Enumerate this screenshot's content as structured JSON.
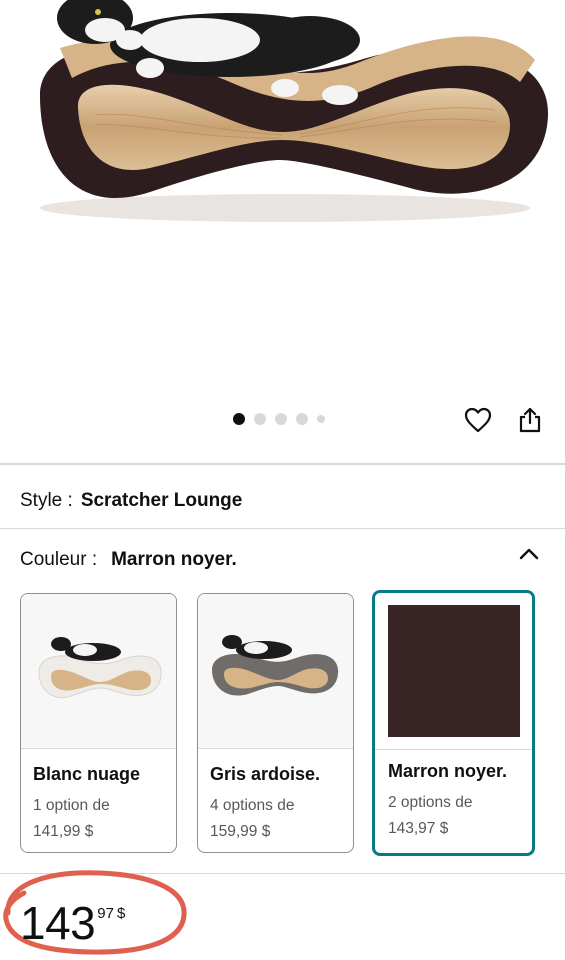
{
  "product": {
    "style_label": "Style :",
    "style_value": "Scratcher Lounge",
    "color_label": "Couleur :",
    "color_value": "Marron noyer."
  },
  "gallery": {
    "image_count": 5,
    "active_index": 0,
    "icons": [
      "heart-icon",
      "share-icon"
    ]
  },
  "swatches": [
    {
      "name": "Blanc nuage",
      "options": "1 option de",
      "price": "141,99 $",
      "body_color": "#f0eeec",
      "selected": false
    },
    {
      "name": "Gris ardoise.",
      "options": "4 options de",
      "price": "159,99 $",
      "body_color": "#6f6c6a",
      "selected": false
    },
    {
      "name": "Marron noyer.",
      "options": "2 options de",
      "price": "143,97 $",
      "body_color": "#3a2526",
      "selected": true
    }
  ],
  "price": {
    "whole": "143",
    "fraction": "97",
    "currency": "$"
  },
  "colors": {
    "selected_border": "#0a7987",
    "annotation_circle": "#e06050",
    "walnut": "#3a2526",
    "cardboard": "#d9b88f"
  }
}
